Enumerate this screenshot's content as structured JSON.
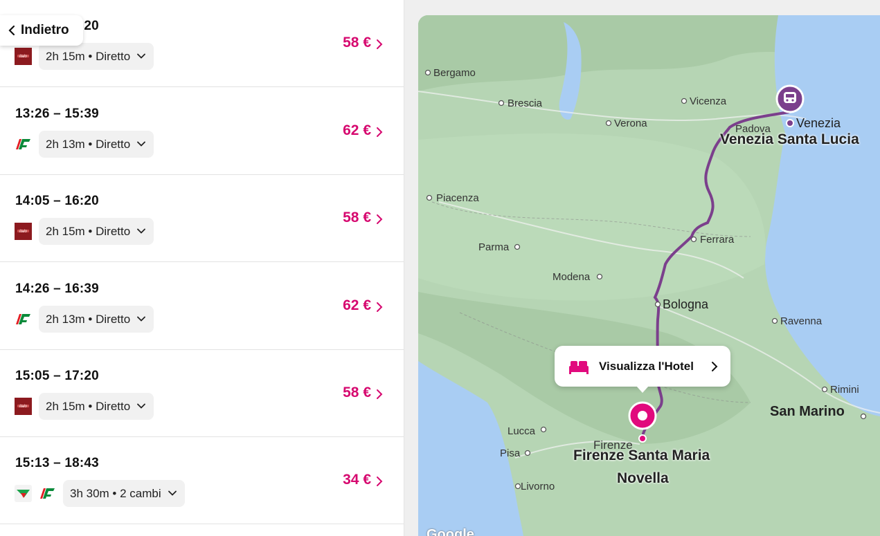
{
  "back": {
    "label": "Indietro"
  },
  "trains": [
    {
      "time": "13:05 – 15:20",
      "duration": "2h 15m • Diretto",
      "price": "58 €",
      "operators": [
        "italo-logo"
      ]
    },
    {
      "time": "13:26 – 15:39",
      "duration": "2h 13m • Diretto",
      "price": "62 €",
      "operators": [
        "trenitalia-logo"
      ]
    },
    {
      "time": "14:05 – 16:20",
      "duration": "2h 15m • Diretto",
      "price": "58 €",
      "operators": [
        "italo-logo"
      ]
    },
    {
      "time": "14:26 – 16:39",
      "duration": "2h 13m • Diretto",
      "price": "62 €",
      "operators": [
        "trenitalia-logo"
      ]
    },
    {
      "time": "15:05 – 17:20",
      "duration": "2h 15m • Diretto",
      "price": "58 €",
      "operators": [
        "italo-logo"
      ]
    },
    {
      "time": "15:13 – 18:43",
      "duration": "3h 30m • 2 cambi",
      "price": "34 €",
      "operators": [
        "flixbus-logo",
        "trenitalia-logo"
      ]
    }
  ],
  "map": {
    "hotel_button": "Visualizza l'Hotel",
    "cities": {
      "bergamo": "Bergamo",
      "brescia": "Brescia",
      "vicenza": "Vicenza",
      "verona": "Verona",
      "padova": "Padova",
      "venezia": "Venezia",
      "venezia_station": "Venezia Santa Lucia",
      "piacenza": "Piacenza",
      "parma": "Parma",
      "ferrara": "Ferrara",
      "modena": "Modena",
      "bologna": "Bologna",
      "ravenna": "Ravenna",
      "rimini": "Rimini",
      "san_marino": "San Marino",
      "lucca": "Lucca",
      "firenze": "Firenze",
      "firenze_station_1": "Firenze Santa Maria",
      "firenze_station_2": "Novella",
      "pisa": "Pisa",
      "livorno": "Livorno"
    },
    "attribution": "Google"
  },
  "colors": {
    "accent": "#d6086f",
    "route": "#7b3f8c",
    "water": "#a9cdf3",
    "land": "#b6d5b4"
  }
}
